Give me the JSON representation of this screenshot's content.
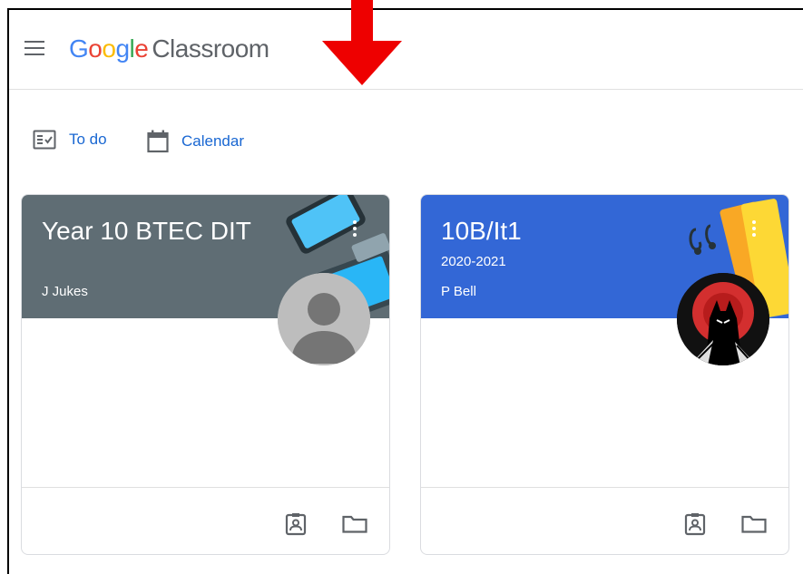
{
  "header": {
    "logo_google": [
      "G",
      "o",
      "o",
      "g",
      "l",
      "e"
    ],
    "logo_product": "Classroom"
  },
  "nav": {
    "todo_label": "To do",
    "calendar_label": "Calendar"
  },
  "classes": [
    {
      "title": "Year 10 BTEC DIT",
      "section": "",
      "teacher": "J Jukes",
      "header_color": "#5f6d74"
    },
    {
      "title": "10B/It1",
      "section": "2020-2021",
      "teacher": "P Bell",
      "header_color": "#3367d6"
    }
  ],
  "colors": {
    "link_blue": "#1967d2",
    "google_blue": "#4285F4",
    "google_red": "#EA4335",
    "google_yellow": "#FBBC05",
    "google_green": "#34A853",
    "annotation_arrow": "#ee0000"
  },
  "icons": {
    "menu": "hamburger-menu-icon",
    "todo": "assignment-check-icon",
    "calendar": "calendar-icon",
    "more": "more-vert-icon",
    "gradebook": "gradebook-icon",
    "folder": "folder-icon"
  }
}
